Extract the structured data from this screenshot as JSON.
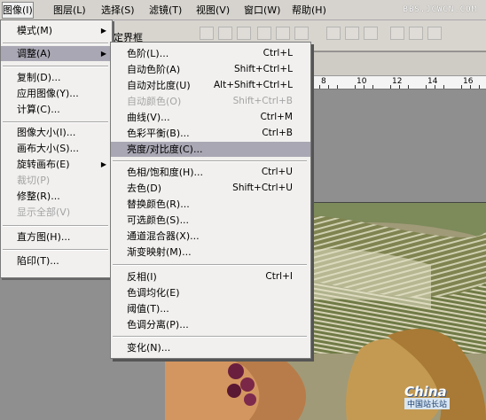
{
  "menubar": {
    "items": [
      "图像(I)",
      "图层(L)",
      "选择(S)",
      "滤镜(T)",
      "视图(V)",
      "窗口(W)",
      "帮助(H)"
    ],
    "watermark": "BBS.JCWCN.COM"
  },
  "options_bar": {
    "label": "定界框"
  },
  "ruler": {
    "labels": [
      "8",
      "10",
      "12",
      "14",
      "16"
    ]
  },
  "image_menu": {
    "items": [
      {
        "label": "模式(M)",
        "submenu": true
      },
      {
        "label": "调整(A)",
        "submenu": true,
        "active": true
      },
      {
        "label": "复制(D)..."
      },
      {
        "label": "应用图像(Y)..."
      },
      {
        "label": "计算(C)..."
      },
      {
        "label": "图像大小(I)..."
      },
      {
        "label": "画布大小(S)..."
      },
      {
        "label": "旋转画布(E)",
        "submenu": true
      },
      {
        "label": "裁切(P)",
        "disabled": true
      },
      {
        "label": "修整(R)..."
      },
      {
        "label": "显示全部(V)",
        "disabled": true
      },
      {
        "label": "直方图(H)..."
      },
      {
        "label": "陷印(T)..."
      }
    ]
  },
  "adjust_submenu": {
    "items": [
      {
        "label": "色阶(L)...",
        "shortcut": "Ctrl+L"
      },
      {
        "label": "自动色阶(A)",
        "shortcut": "Shift+Ctrl+L"
      },
      {
        "label": "自动对比度(U)",
        "shortcut": "Alt+Shift+Ctrl+L"
      },
      {
        "label": "自动颜色(O)",
        "shortcut": "Shift+Ctrl+B",
        "disabled": true
      },
      {
        "label": "曲线(V)...",
        "shortcut": "Ctrl+M"
      },
      {
        "label": "色彩平衡(B)...",
        "shortcut": "Ctrl+B"
      },
      {
        "label": "亮度/对比度(C)...",
        "shortcut": "",
        "highlighted": true
      },
      {
        "label": "色相/饱和度(H)...",
        "shortcut": "Ctrl+U"
      },
      {
        "label": "去色(D)",
        "shortcut": "Shift+Ctrl+U"
      },
      {
        "label": "替换颜色(R)...",
        "shortcut": ""
      },
      {
        "label": "可选颜色(S)...",
        "shortcut": ""
      },
      {
        "label": "通道混合器(X)...",
        "shortcut": ""
      },
      {
        "label": "渐变映射(M)...",
        "shortcut": ""
      },
      {
        "label": "反相(I)",
        "shortcut": "Ctrl+I"
      },
      {
        "label": "色调均化(E)",
        "shortcut": ""
      },
      {
        "label": "阈值(T)...",
        "shortcut": ""
      },
      {
        "label": "色调分离(P)...",
        "shortcut": ""
      },
      {
        "label": "变化(N)...",
        "shortcut": ""
      }
    ]
  },
  "logo": {
    "brand": "China",
    "tagline": "中国站长站"
  },
  "colors": {
    "menu_bg": "#f1f0ee",
    "highlight": "#a9a7b3",
    "disabled": "#a4a4a4",
    "bar": "#d6d3ce"
  }
}
